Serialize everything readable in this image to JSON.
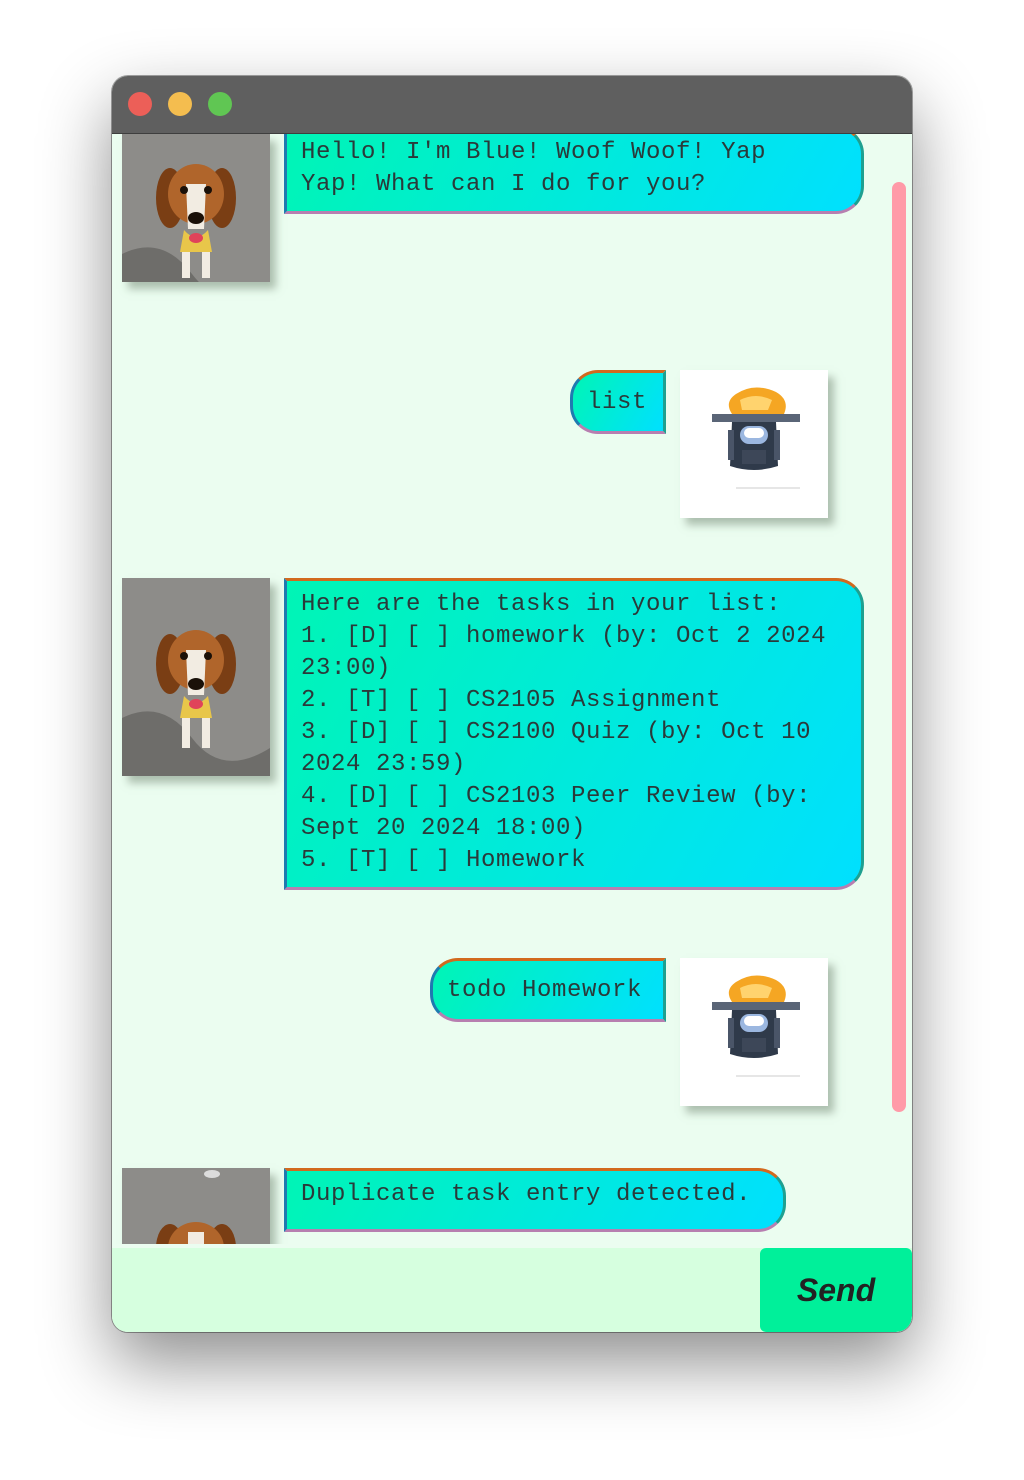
{
  "window": {
    "controls": [
      "close",
      "minimize",
      "maximize"
    ]
  },
  "messages": [
    {
      "sender": "bot",
      "avatar": "dog-avatar",
      "text": "Hello! I'm Blue! Woof Woof! Yap\nYap! What can I do for you?"
    },
    {
      "sender": "user",
      "avatar": "user-avatar",
      "text": "list"
    },
    {
      "sender": "bot",
      "avatar": "dog-avatar",
      "text": "Here are the tasks in your list:\n1. [D] [ ] homework (by: Oct 2 2024\n23:00)\n2. [T] [ ] CS2105 Assignment\n3. [D] [ ] CS2100 Quiz (by: Oct 10\n2024 23:59)\n4. [D] [ ] CS2103 Peer Review (by:\nSept 20 2024 18:00)\n5. [T] [ ] Homework"
    },
    {
      "sender": "user",
      "avatar": "user-avatar",
      "text": "todo Homework"
    },
    {
      "sender": "bot",
      "avatar": "dog-avatar",
      "text": "Duplicate task entry detected."
    }
  ],
  "input": {
    "value": "",
    "placeholder": "",
    "send_label": "Send"
  },
  "colors": {
    "background": "#ebfdf0",
    "bubble_start": "#00f5b5",
    "bubble_end": "#00e0ff",
    "send_button": "#00f09a",
    "scrollbar": "#ff9aa8",
    "input_bar": "#d6ffdf"
  }
}
